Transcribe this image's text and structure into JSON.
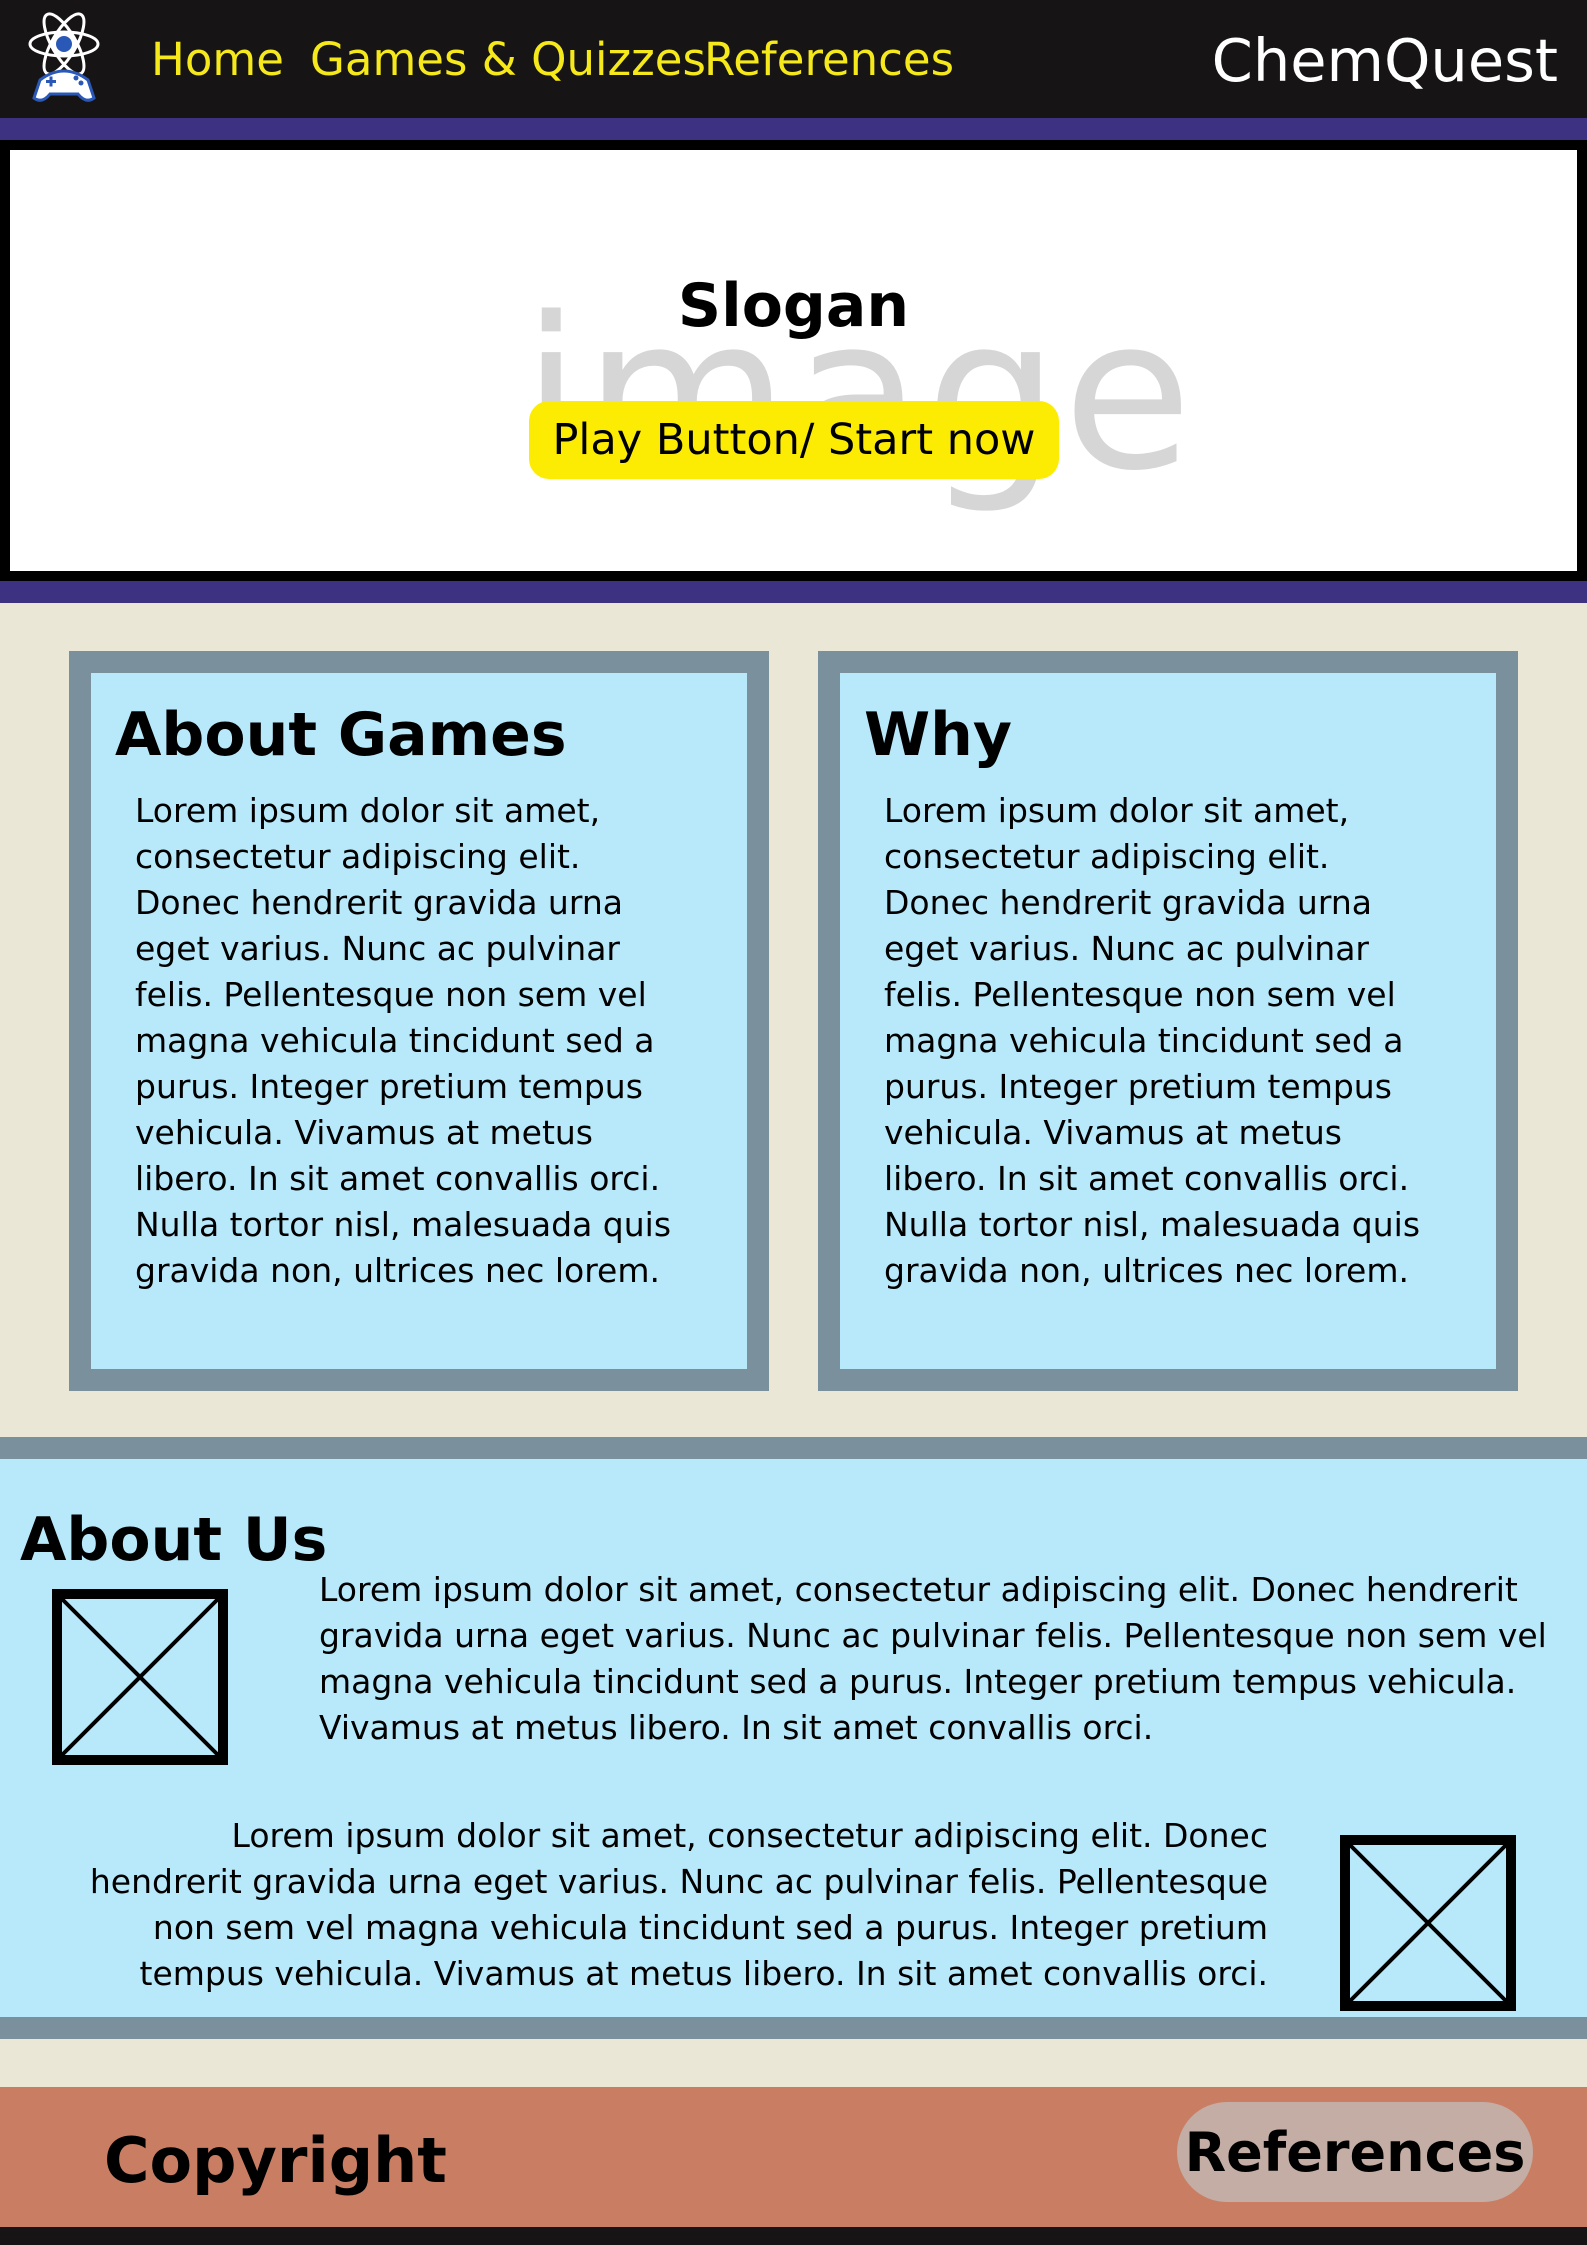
{
  "nav": {
    "links": [
      "Home",
      "Games & Quizzes",
      "References"
    ],
    "brand": "ChemQuest",
    "logo_icon": "atom-gamepad-icon"
  },
  "hero": {
    "placeholder": "image",
    "slogan": "Slogan",
    "cta_label": "Play Button/ Start now"
  },
  "cards": [
    {
      "title": "About Games",
      "text": "Lorem ipsum dolor sit amet, consectetur adipiscing elit. Donec hendrerit gravida urna eget varius. Nunc ac pulvinar felis. Pellentesque non sem vel magna vehicula tincidunt sed a purus. Integer pretium tempus vehicula. Vivamus at metus libero. In sit amet convallis orci. Nulla tortor nisl, malesuada quis gravida non, ultrices nec lorem."
    },
    {
      "title": "Why",
      "text": "Lorem ipsum dolor sit amet, consectetur adipiscing elit. Donec hendrerit gravida urna eget varius. Nunc ac pulvinar felis. Pellentesque non sem vel magna vehicula tincidunt sed a purus. Integer pretium tempus vehicula. Vivamus at metus libero. In sit amet convallis orci. Nulla tortor nisl, malesuada quis gravida non, ultrices nec lorem."
    }
  ],
  "about": {
    "title": "About Us",
    "paragraphs": [
      "Lorem ipsum dolor sit amet, consectetur adipiscing elit. Donec hendrerit gravida urna eget varius. Nunc ac pulvinar felis. Pellentesque non sem vel magna vehicula tincidunt sed a purus. Integer pretium tempus vehicula. Vivamus at metus libero. In sit amet convallis orci.",
      "Lorem ipsum dolor sit amet, consectetur adipiscing elit. Donec hendrerit gravida urna eget varius. Nunc ac pulvinar felis. Pellentesque non sem vel magna vehicula tincidunt sed a purus. Integer pretium tempus vehicula. Vivamus at metus libero. In sit amet convallis orci."
    ]
  },
  "footer": {
    "copyright": "Copyright",
    "references_label": "References"
  },
  "colors": {
    "nav_bg": "#161414",
    "nav_link": "#f5e81b",
    "band": "#3d3282",
    "page_bg": "#ebe7d6",
    "card_border": "#7a919d",
    "card_fill": "#b8e9fb",
    "cta": "#fcec04",
    "footer_bg": "#c97e64",
    "footer_button": "#c4ada4"
  }
}
